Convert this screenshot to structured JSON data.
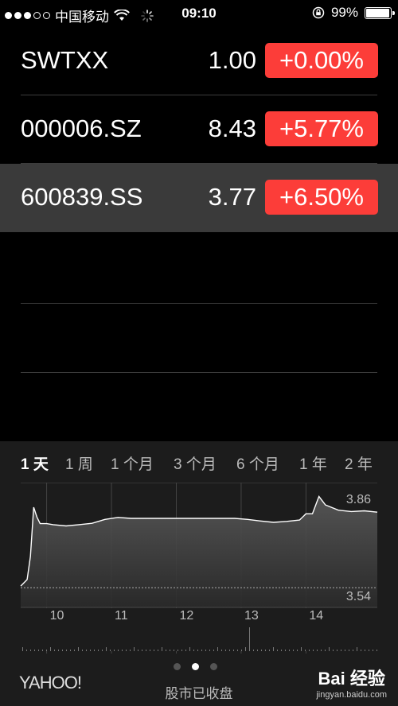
{
  "status_bar": {
    "carrier": "中国移动",
    "time": "09:10",
    "battery": "99%",
    "battery_level": 0.99
  },
  "stocks": [
    {
      "symbol": "SWTXX",
      "price": "1.00",
      "change": "+0.00%"
    },
    {
      "symbol": "000006.SZ",
      "price": "8.43",
      "change": "+5.77%"
    },
    {
      "symbol": "600839.SS",
      "price": "3.77",
      "change": "+6.50%",
      "selected": true
    }
  ],
  "range_tabs": [
    "1 天",
    "1 周",
    "1 个月",
    "3 个月",
    "6 个月",
    "1 年",
    "2 年"
  ],
  "active_range": "1 天",
  "chart_data": {
    "type": "area",
    "y_high_label": "3.86",
    "y_low_label": "3.54",
    "ylim": [
      3.5,
      3.88
    ],
    "x_tick_labels": [
      "10",
      "11",
      "12",
      "13",
      "14"
    ],
    "x": [
      9.5,
      9.55,
      9.6,
      9.65,
      9.7,
      9.75,
      9.8,
      9.9,
      10.0,
      10.2,
      10.4,
      10.6,
      10.8,
      11.0,
      11.2,
      11.4,
      11.6,
      11.8,
      12.0,
      12.2,
      12.4,
      12.6,
      12.8,
      13.0,
      13.2,
      13.4,
      13.6,
      13.8,
      13.9,
      14.0,
      14.1,
      14.2,
      14.4,
      14.6,
      14.8,
      15.0
    ],
    "values": [
      3.565,
      3.575,
      3.585,
      3.655,
      3.805,
      3.775,
      3.755,
      3.755,
      3.752,
      3.748,
      3.752,
      3.756,
      3.768,
      3.774,
      3.771,
      3.771,
      3.771,
      3.771,
      3.771,
      3.771,
      3.771,
      3.771,
      3.771,
      3.768,
      3.763,
      3.759,
      3.762,
      3.766,
      3.785,
      3.785,
      3.838,
      3.812,
      3.796,
      3.792,
      3.794,
      3.79
    ]
  },
  "footer": {
    "brand": "YAHOO!",
    "market_status": "股市已收盘",
    "watermark_main": "Bai 经验",
    "watermark_sub": "jingyan.baidu.com"
  },
  "colors": {
    "change_positive": "#fc3d39",
    "selected_row": "#3a3a3a",
    "chart_bg": "#1c1c1c"
  }
}
